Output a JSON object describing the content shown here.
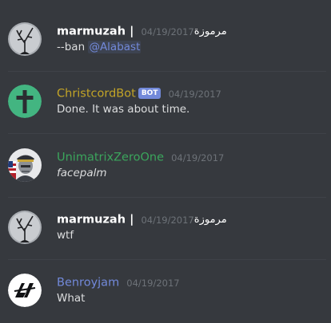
{
  "colors": {
    "background": "#36393e",
    "divider": "#3f4248",
    "text": "#dcddde",
    "timestamp": "#6d7278",
    "mention": "#7289da",
    "bot_tag": "#7289da"
  },
  "messages": [
    {
      "author": "marmuzah |",
      "author_color": "#ffffff",
      "timestamp": "04/19/2017",
      "author_suffix": "مرموزة",
      "content_prefix": "--ban ",
      "mention": "@Alabast",
      "avatar_icon": "tree-silhouette-avatar"
    },
    {
      "author": "ChristcordBot",
      "author_color": "#c2a427",
      "bot_tag": "BOT",
      "timestamp": "04/19/2017",
      "content": "Done. It was about time.",
      "avatar_icon": "cross-avatar"
    },
    {
      "author": "UnimatrixZeroOne",
      "author_color": "#3ba55c",
      "timestamp": "04/19/2017",
      "content": "facepalm",
      "avatar_icon": "officer-avatar"
    },
    {
      "author": "marmuzah |",
      "author_color": "#ffffff",
      "timestamp": "04/19/2017",
      "author_suffix": "مرموزة",
      "content": "wtf",
      "avatar_icon": "tree-silhouette-avatar"
    },
    {
      "author": "Benroyjam",
      "author_color": "#7289da",
      "timestamp": "04/19/2017",
      "content": "What",
      "avatar_icon": "logo-avatar"
    }
  ]
}
